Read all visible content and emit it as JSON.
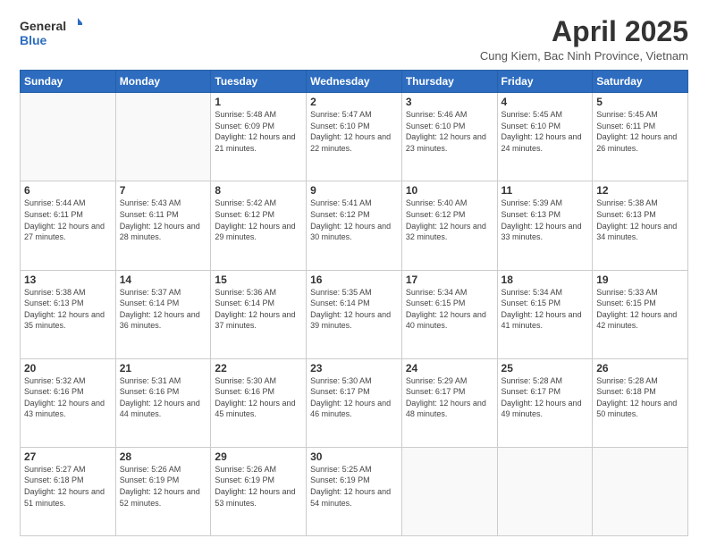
{
  "logo": {
    "general": "General",
    "blue": "Blue"
  },
  "header": {
    "title": "April 2025",
    "subtitle": "Cung Kiem, Bac Ninh Province, Vietnam"
  },
  "days_of_week": [
    "Sunday",
    "Monday",
    "Tuesday",
    "Wednesday",
    "Thursday",
    "Friday",
    "Saturday"
  ],
  "weeks": [
    [
      {
        "day": "",
        "info": ""
      },
      {
        "day": "",
        "info": ""
      },
      {
        "day": "1",
        "info": "Sunrise: 5:48 AM\nSunset: 6:09 PM\nDaylight: 12 hours and 21 minutes."
      },
      {
        "day": "2",
        "info": "Sunrise: 5:47 AM\nSunset: 6:10 PM\nDaylight: 12 hours and 22 minutes."
      },
      {
        "day": "3",
        "info": "Sunrise: 5:46 AM\nSunset: 6:10 PM\nDaylight: 12 hours and 23 minutes."
      },
      {
        "day": "4",
        "info": "Sunrise: 5:45 AM\nSunset: 6:10 PM\nDaylight: 12 hours and 24 minutes."
      },
      {
        "day": "5",
        "info": "Sunrise: 5:45 AM\nSunset: 6:11 PM\nDaylight: 12 hours and 26 minutes."
      }
    ],
    [
      {
        "day": "6",
        "info": "Sunrise: 5:44 AM\nSunset: 6:11 PM\nDaylight: 12 hours and 27 minutes."
      },
      {
        "day": "7",
        "info": "Sunrise: 5:43 AM\nSunset: 6:11 PM\nDaylight: 12 hours and 28 minutes."
      },
      {
        "day": "8",
        "info": "Sunrise: 5:42 AM\nSunset: 6:12 PM\nDaylight: 12 hours and 29 minutes."
      },
      {
        "day": "9",
        "info": "Sunrise: 5:41 AM\nSunset: 6:12 PM\nDaylight: 12 hours and 30 minutes."
      },
      {
        "day": "10",
        "info": "Sunrise: 5:40 AM\nSunset: 6:12 PM\nDaylight: 12 hours and 32 minutes."
      },
      {
        "day": "11",
        "info": "Sunrise: 5:39 AM\nSunset: 6:13 PM\nDaylight: 12 hours and 33 minutes."
      },
      {
        "day": "12",
        "info": "Sunrise: 5:38 AM\nSunset: 6:13 PM\nDaylight: 12 hours and 34 minutes."
      }
    ],
    [
      {
        "day": "13",
        "info": "Sunrise: 5:38 AM\nSunset: 6:13 PM\nDaylight: 12 hours and 35 minutes."
      },
      {
        "day": "14",
        "info": "Sunrise: 5:37 AM\nSunset: 6:14 PM\nDaylight: 12 hours and 36 minutes."
      },
      {
        "day": "15",
        "info": "Sunrise: 5:36 AM\nSunset: 6:14 PM\nDaylight: 12 hours and 37 minutes."
      },
      {
        "day": "16",
        "info": "Sunrise: 5:35 AM\nSunset: 6:14 PM\nDaylight: 12 hours and 39 minutes."
      },
      {
        "day": "17",
        "info": "Sunrise: 5:34 AM\nSunset: 6:15 PM\nDaylight: 12 hours and 40 minutes."
      },
      {
        "day": "18",
        "info": "Sunrise: 5:34 AM\nSunset: 6:15 PM\nDaylight: 12 hours and 41 minutes."
      },
      {
        "day": "19",
        "info": "Sunrise: 5:33 AM\nSunset: 6:15 PM\nDaylight: 12 hours and 42 minutes."
      }
    ],
    [
      {
        "day": "20",
        "info": "Sunrise: 5:32 AM\nSunset: 6:16 PM\nDaylight: 12 hours and 43 minutes."
      },
      {
        "day": "21",
        "info": "Sunrise: 5:31 AM\nSunset: 6:16 PM\nDaylight: 12 hours and 44 minutes."
      },
      {
        "day": "22",
        "info": "Sunrise: 5:30 AM\nSunset: 6:16 PM\nDaylight: 12 hours and 45 minutes."
      },
      {
        "day": "23",
        "info": "Sunrise: 5:30 AM\nSunset: 6:17 PM\nDaylight: 12 hours and 46 minutes."
      },
      {
        "day": "24",
        "info": "Sunrise: 5:29 AM\nSunset: 6:17 PM\nDaylight: 12 hours and 48 minutes."
      },
      {
        "day": "25",
        "info": "Sunrise: 5:28 AM\nSunset: 6:17 PM\nDaylight: 12 hours and 49 minutes."
      },
      {
        "day": "26",
        "info": "Sunrise: 5:28 AM\nSunset: 6:18 PM\nDaylight: 12 hours and 50 minutes."
      }
    ],
    [
      {
        "day": "27",
        "info": "Sunrise: 5:27 AM\nSunset: 6:18 PM\nDaylight: 12 hours and 51 minutes."
      },
      {
        "day": "28",
        "info": "Sunrise: 5:26 AM\nSunset: 6:19 PM\nDaylight: 12 hours and 52 minutes."
      },
      {
        "day": "29",
        "info": "Sunrise: 5:26 AM\nSunset: 6:19 PM\nDaylight: 12 hours and 53 minutes."
      },
      {
        "day": "30",
        "info": "Sunrise: 5:25 AM\nSunset: 6:19 PM\nDaylight: 12 hours and 54 minutes."
      },
      {
        "day": "",
        "info": ""
      },
      {
        "day": "",
        "info": ""
      },
      {
        "day": "",
        "info": ""
      }
    ]
  ]
}
